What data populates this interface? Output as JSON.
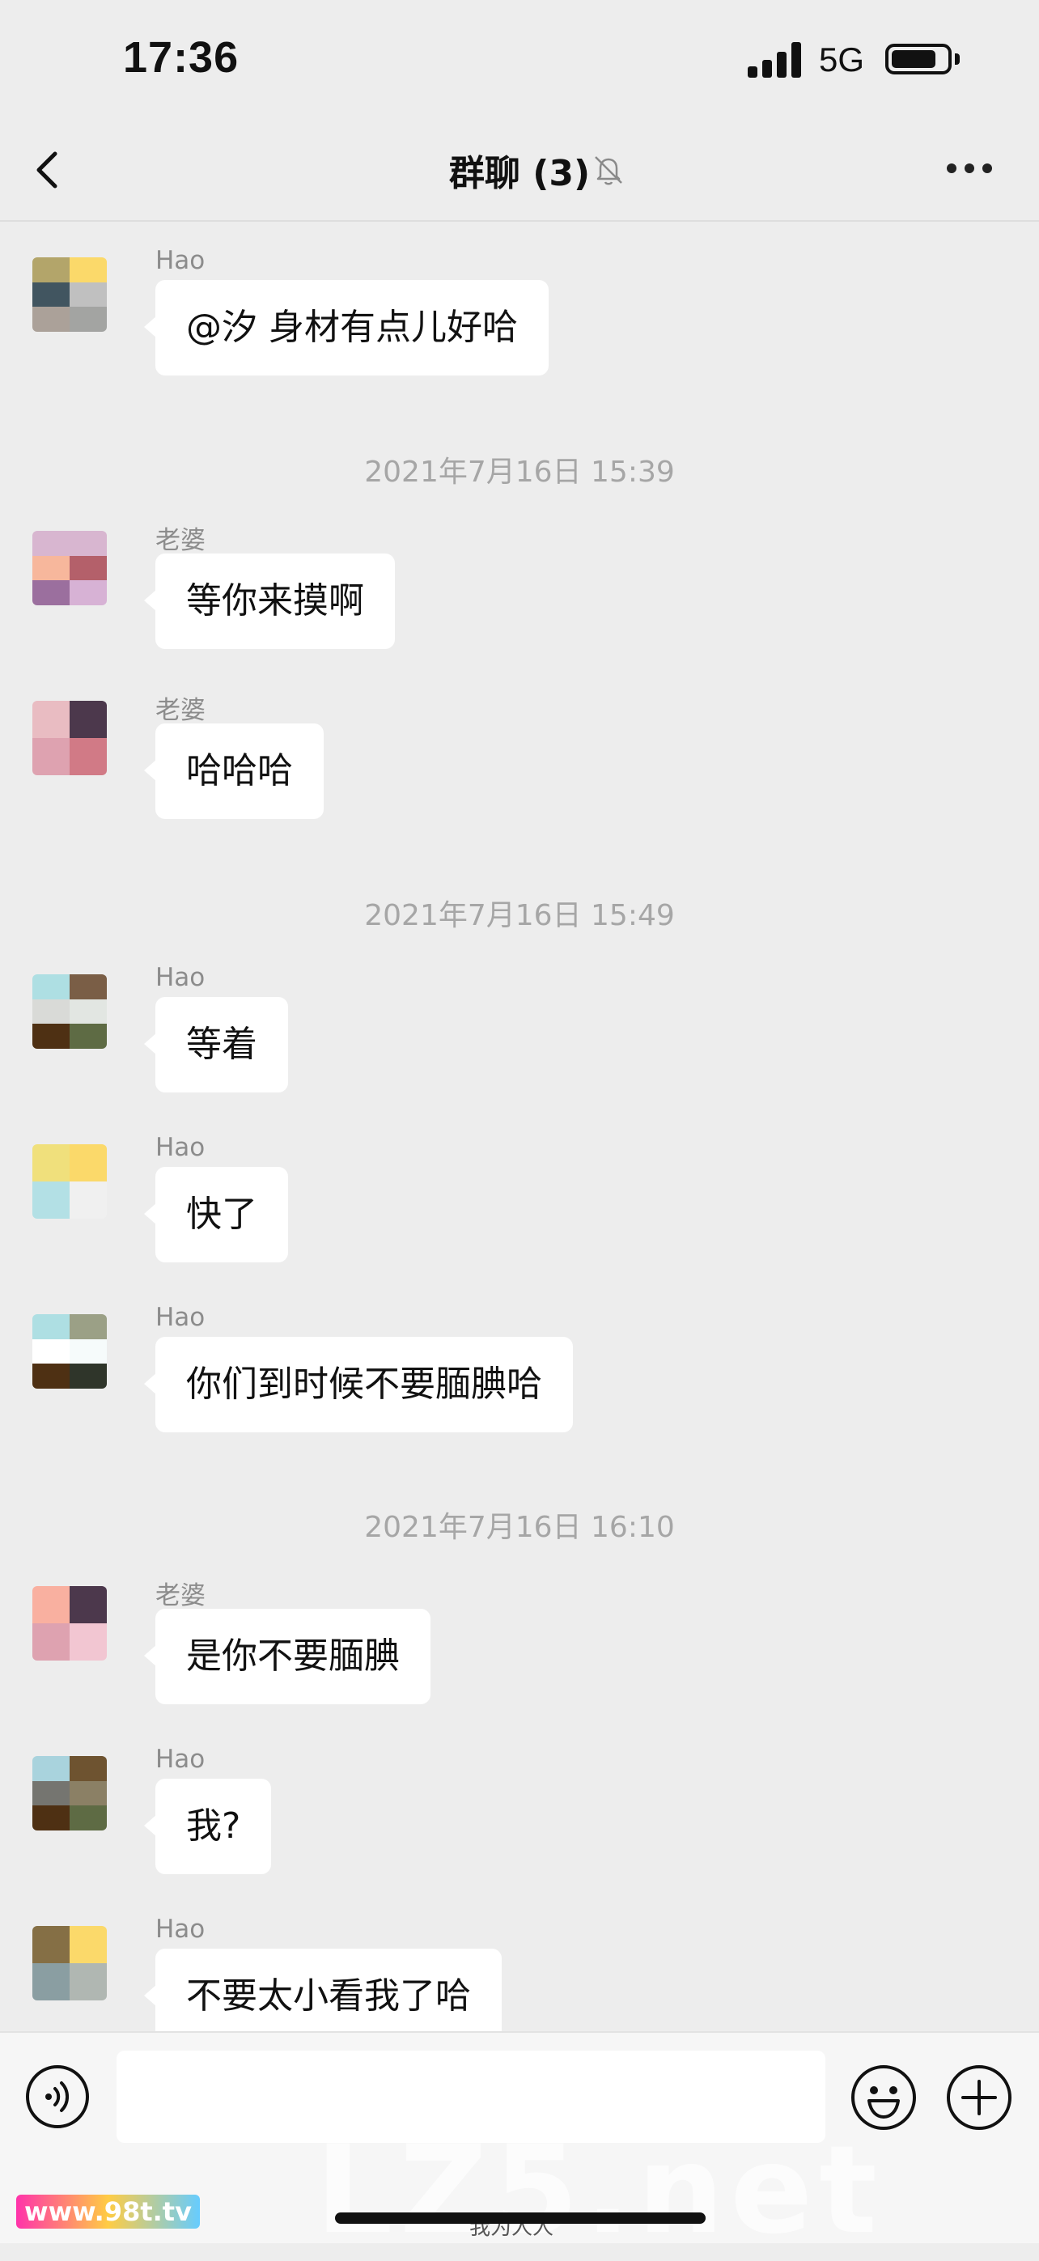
{
  "status_bar": {
    "time": "17:36",
    "network": "5G"
  },
  "nav": {
    "title": "群聊 (3)",
    "back_icon": "chevron-left-icon",
    "mute_icon": "bell-off-icon",
    "more_icon": "more-dots-icon"
  },
  "messages": [
    {
      "sender": "Hao",
      "text": "@汐 身材有点儿好哈",
      "avatar_colors": [
        "#b3a56a",
        "#fbd96a",
        "#415560",
        "#c0c0c0",
        "#aba199",
        "#a3a4a2"
      ]
    },
    {
      "sender": "老婆",
      "text": "等你来摸啊",
      "avatar_colors": [
        "#d8b6d0",
        "#d8b6d0",
        "#f7b79c",
        "#b4606a",
        "#9b6f9e",
        "#d7b2d5"
      ]
    },
    {
      "sender": "老婆",
      "text": "哈哈哈",
      "avatar_colors": [
        "#e9bcc2",
        "#4c384c",
        "#dea2b0",
        "#d17a86"
      ]
    },
    {
      "sender": "Hao",
      "text": "等着",
      "avatar_colors": [
        "#aedfe3",
        "#7a5e46",
        "#d9dad7",
        "#e2e6e2",
        "#4e3013",
        "#5e6b44"
      ]
    },
    {
      "sender": "Hao",
      "text": "快了",
      "avatar_colors": [
        "#f0e07c",
        "#fbd96a",
        "#b3e0e5",
        "#f0f0f0"
      ]
    },
    {
      "sender": "Hao",
      "text": "你们到时候不要腼腆哈",
      "avatar_colors": [
        "#aedfe3",
        "#9ba086",
        "#ffffff",
        "#f6fbfb",
        "#4e3013",
        "#2f352a"
      ]
    },
    {
      "sender": "老婆",
      "text": "是你不要腼腆",
      "avatar_colors": [
        "#f9b0a0",
        "#4c384c",
        "#dea2b0",
        "#f2c6d2"
      ]
    },
    {
      "sender": "Hao",
      "text": "我?",
      "avatar_colors": [
        "#a9d3dd",
        "#6e5330",
        "#757570",
        "#8b8065",
        "#4e3013",
        "#5e6b44"
      ]
    },
    {
      "sender": "Hao",
      "text": "不要太小看我了哈",
      "avatar_colors": [
        "#856f45",
        "#fbd96a",
        "#8a9ea2",
        "#b0b7b2"
      ]
    }
  ],
  "timestamps": [
    "2021年7月16日 15:39",
    "2021年7月16日 15:49",
    "2021年7月16日 16:10"
  ],
  "input_bar": {
    "placeholder": "",
    "voice_icon": "voice-icon",
    "emoji_icon": "emoji-icon",
    "plus_icon": "plus-icon"
  },
  "watermarks": {
    "big": "LZ5.net",
    "small": "www.98t.tv",
    "bottom": "我为人人"
  }
}
